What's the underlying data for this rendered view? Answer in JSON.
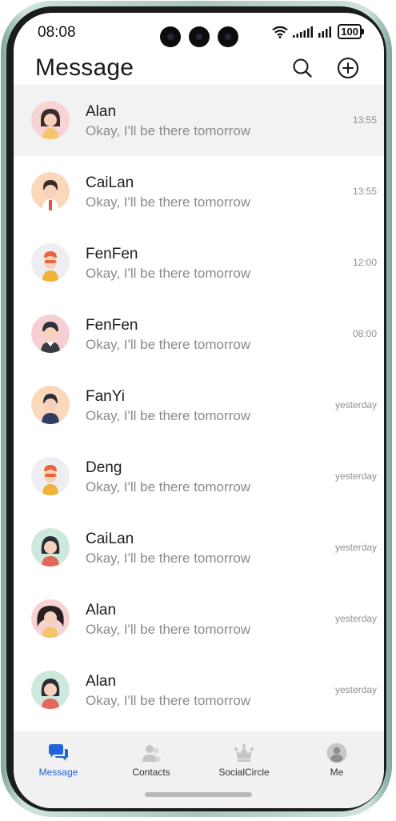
{
  "status_bar": {
    "time": "08:08",
    "battery": "100"
  },
  "header": {
    "title": "Message",
    "search_icon": "search-icon",
    "add_icon": "add-circle-icon"
  },
  "conversations": [
    {
      "name": "Alan",
      "preview": "Okay, I'll be there tomorrow",
      "time": "13:55"
    },
    {
      "name": "CaiLan",
      "preview": "Okay, I'll be there tomorrow",
      "time": "13:55"
    },
    {
      "name": "FenFen",
      "preview": "Okay, I'll be there tomorrow",
      "time": "12:00"
    },
    {
      "name": "FenFen",
      "preview": "Okay, I'll be there tomorrow",
      "time": "08:00"
    },
    {
      "name": "FanYi",
      "preview": "Okay, I'll be there tomorrow",
      "time": "yesterday"
    },
    {
      "name": "Deng",
      "preview": "Okay, I'll be there tomorrow",
      "time": "yesterday"
    },
    {
      "name": "CaiLan",
      "preview": "Okay, I'll be there tomorrow",
      "time": "yesterday"
    },
    {
      "name": "Alan",
      "preview": "Okay, I'll be there tomorrow",
      "time": "yesterday"
    },
    {
      "name": "Alan",
      "preview": "Okay, I'll be there tomorrow",
      "time": "yesterday"
    }
  ],
  "tabs": [
    {
      "label": "Message",
      "icon": "chat-bubbles-icon"
    },
    {
      "label": "Contacts",
      "icon": "contacts-icon"
    },
    {
      "label": "SocialCircle",
      "icon": "crown-icon"
    },
    {
      "label": "Me",
      "icon": "profile-icon"
    }
  ],
  "colors": {
    "accent": "#2163d9",
    "selected_row": "#f2f2f2",
    "tab_bar": "#f1f1f1"
  }
}
